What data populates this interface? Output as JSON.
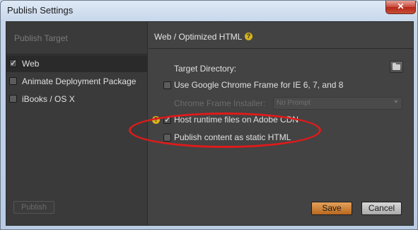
{
  "window": {
    "title": "Publish Settings",
    "close_glyph": "✕"
  },
  "sidebar": {
    "header": "Publish Target",
    "items": [
      {
        "label": "Web",
        "checked": true,
        "selected": true
      },
      {
        "label": "Animate Deployment Package",
        "checked": false,
        "selected": false
      },
      {
        "label": "iBooks / OS X",
        "checked": false,
        "selected": false
      }
    ],
    "publish_label": "Publish"
  },
  "main": {
    "title": "Web / Optimized HTML",
    "help_glyph": "?",
    "target_directory_label": "Target Directory:",
    "options": {
      "chrome_frame": {
        "label": "Use Google Chrome Frame for IE 6, 7, and 8",
        "checked": false
      },
      "chrome_installer_label": "Chrome Frame Installer:",
      "chrome_installer_value": "No Prompt",
      "host_cdn": {
        "label": "Host runtime files on Adobe CDN",
        "checked": true
      },
      "static_html": {
        "label": "Publish content as static HTML",
        "checked": false
      }
    },
    "check_glyph": "✓"
  },
  "footer": {
    "save_label": "Save",
    "cancel_label": "Cancel"
  },
  "colors": {
    "annotation": "#e01a1a",
    "accent_save": "#d48a3c",
    "help_icon": "#d7b21e"
  },
  "icons": [
    "close-icon",
    "folder-icon",
    "help-icon",
    "checkbox-icon",
    "dropdown-arrow-icon"
  ]
}
